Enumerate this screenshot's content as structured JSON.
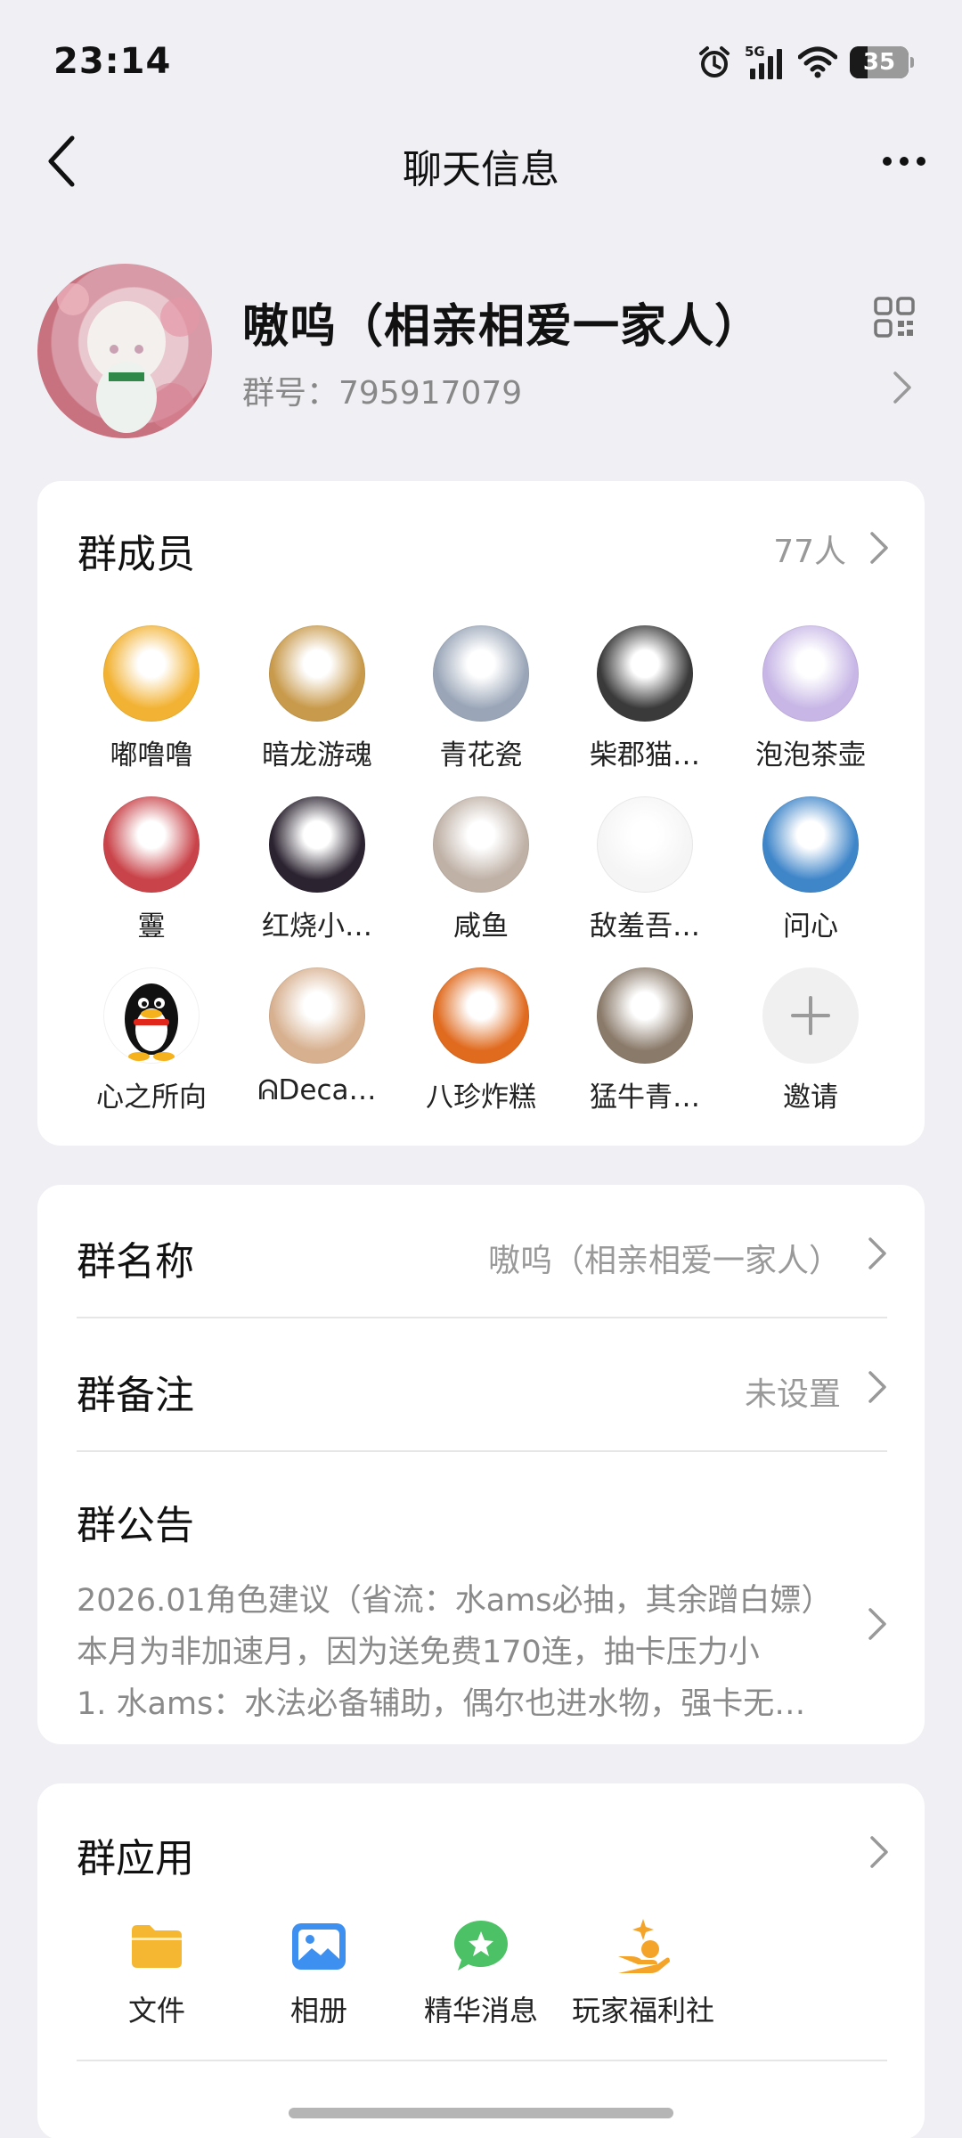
{
  "status_bar": {
    "time": "23:14",
    "network": "5G",
    "battery": "35"
  },
  "nav": {
    "title": "聊天信息"
  },
  "group": {
    "name": "嗷呜（相亲相爱一家人）",
    "number_label": "群号：795917079"
  },
  "members": {
    "label": "群成员",
    "count": "77人",
    "items": [
      {
        "name": "嘟噜噜",
        "color": "#f2b233"
      },
      {
        "name": "暗龙游魂",
        "color": "#c89a4b"
      },
      {
        "name": "青花瓷",
        "color": "#9aa6b8"
      },
      {
        "name": "柴郡猫…",
        "color": "#3a3a3a"
      },
      {
        "name": "泡泡茶壶",
        "color": "#c7b6e6"
      },
      {
        "name": "霻",
        "color": "#c9444a"
      },
      {
        "name": "红烧小…",
        "color": "#2b2330"
      },
      {
        "name": "咸鱼",
        "color": "#bfb1a6"
      },
      {
        "name": "敌羞吾…",
        "color": "#f5f5f5"
      },
      {
        "name": "问心",
        "color": "#3f86c9"
      },
      {
        "name": "心之所向",
        "color": "#ffffff"
      },
      {
        "name": "ᕱDeca…",
        "color": "#d7b08f"
      },
      {
        "name": "八珍炸糕",
        "color": "#e06a1e"
      },
      {
        "name": "猛牛青…",
        "color": "#8a7a6a"
      }
    ],
    "invite_label": "邀请"
  },
  "settings": {
    "group_name_label": "群名称",
    "group_name_value": "嗷呜（相亲相爱一家人）",
    "remark_label": "群备注",
    "remark_value": "未设置",
    "notice_label": "群公告",
    "notice_lines": [
      "2026.01角色建议（省流：水ams必抽，其余蹭白嫖）",
      "本月为非加速月，因为送免费170连，抽卡压力小",
      "1. 水ams：水法必备辅助，偶尔也进水物，强卡无…"
    ]
  },
  "apps": {
    "label": "群应用",
    "items": [
      {
        "label": "文件",
        "icon": "folder-icon",
        "color": "#f5b731"
      },
      {
        "label": "相册",
        "icon": "photo-album-icon",
        "color": "#3d8ff0"
      },
      {
        "label": "精华消息",
        "icon": "star-message-icon",
        "color": "#4cc165"
      },
      {
        "label": "玩家福利社",
        "icon": "gift-hand-icon",
        "color": "#f4a429"
      }
    ]
  }
}
